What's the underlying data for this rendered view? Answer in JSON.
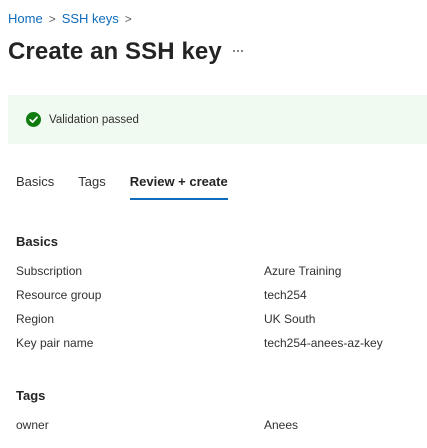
{
  "breadcrumb": {
    "items": [
      "Home",
      "SSH keys"
    ],
    "separator": ">"
  },
  "page": {
    "title": "Create an SSH key",
    "more_icon": "more-icon"
  },
  "banner": {
    "icon": "check-circle-icon",
    "message": "Validation passed",
    "color": "#107c10",
    "background": "#f1faf1"
  },
  "tabs": [
    {
      "label": "Basics",
      "active": false
    },
    {
      "label": "Tags",
      "active": false
    },
    {
      "label": "Review + create",
      "active": true
    }
  ],
  "sections": {
    "basics": {
      "title": "Basics",
      "rows": [
        {
          "label": "Subscription",
          "value": "Azure Training"
        },
        {
          "label": "Resource group",
          "value": "tech254"
        },
        {
          "label": "Region",
          "value": "UK South"
        },
        {
          "label": "Key pair name",
          "value": "tech254-anees-az-key"
        }
      ]
    },
    "tags": {
      "title": "Tags",
      "rows": [
        {
          "label": "owner",
          "value": "Anees"
        }
      ]
    }
  },
  "colors": {
    "accent": "#0f6cbd",
    "text": "#323130"
  }
}
